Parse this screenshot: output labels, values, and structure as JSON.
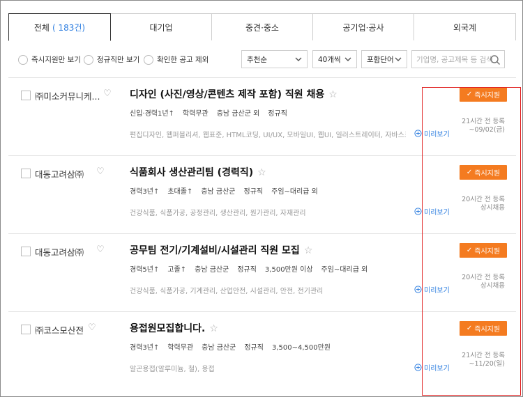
{
  "tabs": [
    {
      "label": "전체",
      "count": "( 183건)",
      "active": true
    },
    {
      "label": "대기업",
      "count": ""
    },
    {
      "label": "중견·중소",
      "count": ""
    },
    {
      "label": "공기업·공사",
      "count": ""
    },
    {
      "label": "외국계",
      "count": ""
    }
  ],
  "filters": {
    "immediate_only": "즉시지원만 보기",
    "regular_only": "정규직만 보기",
    "exclude_seen": "확인한 공고 제외",
    "sort": "추천순",
    "per_page": "40개씩",
    "scope": "포함단어",
    "search_placeholder": "기업명, 공고제목 등 검색"
  },
  "actions": {
    "apply_label": "즉시지원",
    "preview_label": "미리보기"
  },
  "jobs": [
    {
      "company": "㈜미소커뮤니케...",
      "title": "디자인 (사진/영상/콘텐츠 제작 포함) 직원 채용",
      "conditions": [
        "신입·경력1년↑",
        "학력무관",
        "충남 금산군 외",
        "정규직"
      ],
      "tags": "편집디자인, 웹퍼블리셔, 웹표준, HTML코딩, UI/UX, 모바일UI, 웹UI, 일러스트레이터, 자바스크립트,...",
      "posted": "21시간 전 등록",
      "deadline": "~09/02(금)"
    },
    {
      "company": "대동고려삼㈜",
      "title": "식품회사 생산관리팀 (경력직)",
      "conditions": [
        "경력3년↑",
        "초대졸↑",
        "충남 금산군",
        "정규직",
        "주임~대리급 외"
      ],
      "tags": "건강식품, 식품가공, 공정관리, 생산관리, 원가관리, 자재관리",
      "posted": "20시간 전 등록",
      "deadline": "상시채용"
    },
    {
      "company": "대동고려삼㈜",
      "title": "공무팀 전기/기계설비/시설관리 직원 모집",
      "conditions": [
        "경력5년↑",
        "고졸↑",
        "충남 금산군",
        "정규직",
        "3,500만원 이상",
        "주임~대리급 외"
      ],
      "tags": "건강식품, 식품가공, 기계관리, 산업안전, 시설관리, 안전, 전기관리",
      "posted": "20시간 전 등록",
      "deadline": "상시채용"
    },
    {
      "company": "㈜코스모산전",
      "title": "용접원모집합니다.",
      "conditions": [
        "경력3년↑",
        "학력무관",
        "충남 금산군",
        "정규직",
        "3,500~4,500만원"
      ],
      "tags": "알곤용접(알루미늄, 철), 용접",
      "posted": "21시간 전 등록",
      "deadline": "~11/20(일)"
    }
  ]
}
